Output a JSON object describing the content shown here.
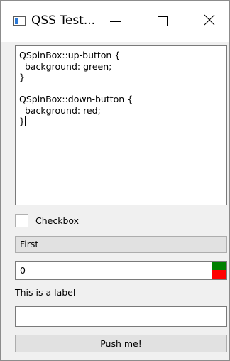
{
  "window": {
    "title": "QSS Test...",
    "icons": {
      "app": "window-app-icon",
      "minimize": "minimize-icon",
      "maximize": "maximize-icon",
      "close": "close-icon"
    }
  },
  "editor": {
    "text": "QSpinBox::up-button {\n  background: green;\n}\n\nQSpinBox::down-button {\n  background: red;\n}"
  },
  "checkbox": {
    "label": "Checkbox",
    "checked": false
  },
  "combo": {
    "selected": "First"
  },
  "spinbox": {
    "value": "0",
    "up_color": "#008000",
    "down_color": "#ff0000"
  },
  "label": {
    "text": "This is a label"
  },
  "lineedit": {
    "value": ""
  },
  "button": {
    "label": "Push me!"
  }
}
